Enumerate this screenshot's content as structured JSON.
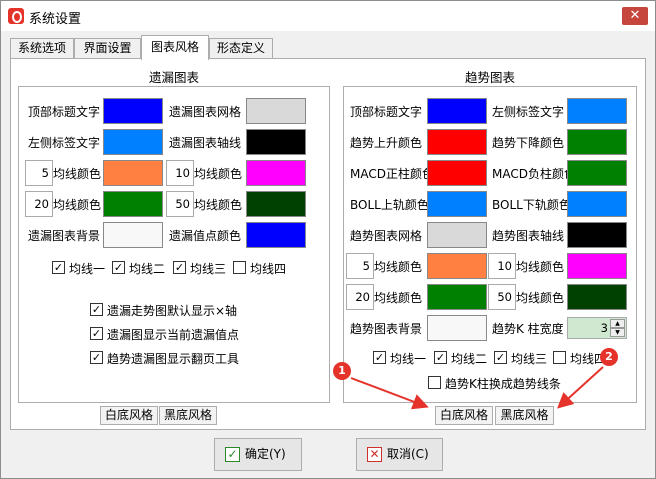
{
  "window": {
    "title": "系统设置",
    "close_glyph": "✕"
  },
  "tabs": [
    "系统选项",
    "界面设置",
    "图表风格",
    "形态定义"
  ],
  "left": {
    "title": "遗漏图表",
    "rows": [
      {
        "label": "顶部标题文字",
        "color": "#0000ff",
        "label2": "遗漏图表网格",
        "color2": "#d9d9d9"
      },
      {
        "label": "左侧标签文字",
        "color": "#0080ff",
        "label2": "遗漏图表轴线",
        "color2": "#000000"
      },
      {
        "num": "5",
        "label": "均线颜色",
        "color": "#ff8040",
        "num2": "10",
        "label2": "均线颜色",
        "color2": "#ff00ff"
      },
      {
        "num": "20",
        "label": "均线颜色",
        "color": "#008000",
        "num2": "50",
        "label2": "均线颜色",
        "color2": "#004000"
      },
      {
        "label": "遗漏图表背景",
        "color": "#f8f8f8",
        "label2": "遗漏值点颜色",
        "color2": "#0000ff"
      }
    ],
    "ma_checks": [
      {
        "label": "均线一",
        "checked": true
      },
      {
        "label": "均线二",
        "checked": true
      },
      {
        "label": "均线三",
        "checked": true
      },
      {
        "label": "均线四",
        "checked": false
      }
    ],
    "options": [
      {
        "label": "遗漏走势图默认显示×轴",
        "checked": true
      },
      {
        "label": "遗漏图显示当前遗漏值点",
        "checked": true
      },
      {
        "label": "趋势遗漏图显示翻页工具",
        "checked": true
      }
    ],
    "style_buttons": [
      "白底风格",
      "黑底风格"
    ]
  },
  "right": {
    "title": "趋势图表",
    "rows": [
      {
        "label": "顶部标题文字",
        "color": "#0000ff",
        "label2": "左侧标签文字",
        "color2": "#0080ff"
      },
      {
        "label": "趋势上升颜色",
        "color": "#ff0000",
        "label2": "趋势下降颜色",
        "color2": "#008000"
      },
      {
        "label": "MACD正柱颜色",
        "color": "#ff0000",
        "label2": "MACD负柱颜色",
        "color2": "#008000"
      },
      {
        "label": "BOLL上轨颜色",
        "color": "#0080ff",
        "label2": "BOLL下轨颜色",
        "color2": "#0080ff"
      },
      {
        "label": "趋势图表网格",
        "color": "#d9d9d9",
        "label2": "趋势图表轴线",
        "color2": "#000000"
      },
      {
        "num": "5",
        "label": "均线颜色",
        "color": "#ff8040",
        "num2": "10",
        "label2": "均线颜色",
        "color2": "#ff00ff"
      },
      {
        "num": "20",
        "label": "均线颜色",
        "color": "#008000",
        "num2": "50",
        "label2": "均线颜色",
        "color2": "#004000"
      },
      {
        "label": "趋势图表背景",
        "color": "#f8f8f8",
        "label2": "趋势K 柱宽度",
        "spin": "3"
      }
    ],
    "ma_checks": [
      {
        "label": "均线一",
        "checked": true
      },
      {
        "label": "均线二",
        "checked": true
      },
      {
        "label": "均线三",
        "checked": true
      },
      {
        "label": "均线四",
        "checked": false
      }
    ],
    "option": {
      "label": "趋势K柱换成趋势线条",
      "checked": false
    },
    "style_buttons": [
      "白底风格",
      "黑底风格"
    ]
  },
  "footer": {
    "ok": "确定(Y)",
    "cancel": "取消(C)"
  },
  "annotations": [
    "1",
    "2"
  ],
  "colors": {
    "annotation": "#e5322a",
    "checkmark": "#1a1a1a"
  },
  "icons": {
    "app": "app-logo-icon",
    "check": "checkmark-icon",
    "ok": "ok-check-icon",
    "cancel": "cancel-x-icon"
  }
}
